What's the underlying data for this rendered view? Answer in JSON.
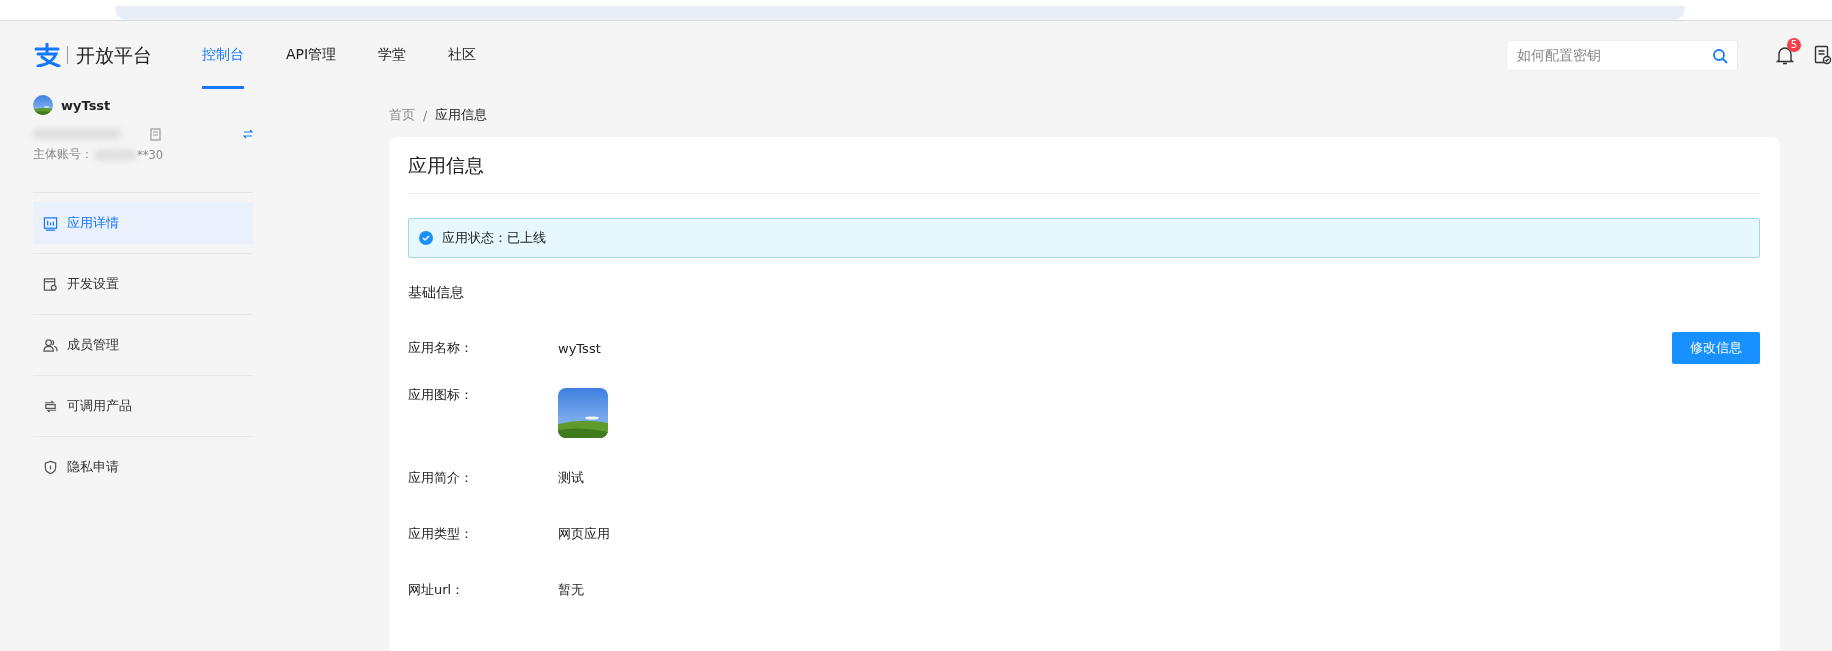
{
  "header": {
    "logo_text": "开放平台",
    "nav": [
      {
        "label": "控制台",
        "selected": true
      },
      {
        "label": "API管理",
        "selected": false
      },
      {
        "label": "学堂",
        "selected": false
      },
      {
        "label": "社区",
        "selected": false
      }
    ],
    "search": {
      "placeholder": "如何配置密钥"
    },
    "notifications": {
      "count": "5"
    }
  },
  "sidebar": {
    "user": {
      "name": "wyTsst",
      "account_label": "主体账号：",
      "account_value": "**30"
    },
    "items": [
      {
        "label": "应用详情",
        "selected": true
      },
      {
        "label": "开发设置",
        "selected": false
      },
      {
        "label": "成员管理",
        "selected": false
      },
      {
        "label": "可调用产品",
        "selected": false
      },
      {
        "label": "隐私申请",
        "selected": false
      }
    ]
  },
  "breadcrumb": {
    "separator": "/",
    "items": [
      {
        "label": "首页",
        "current": false
      },
      {
        "label": "应用信息",
        "current": true
      }
    ]
  },
  "page": {
    "title": "应用信息",
    "alert": "应用状态：已上线",
    "section_title": "基础信息",
    "edit_button": "修改信息",
    "fields": [
      {
        "label": "应用名称：",
        "kind": "text",
        "value": "wyTsst"
      },
      {
        "label": "应用图标：",
        "kind": "picture"
      },
      {
        "label": "应用简介：",
        "kind": "text",
        "value": "测试"
      },
      {
        "label": "应用类型：",
        "kind": "text",
        "value": "网页应用"
      },
      {
        "label": "网址url：",
        "kind": "text",
        "value": "暂无"
      }
    ]
  }
}
